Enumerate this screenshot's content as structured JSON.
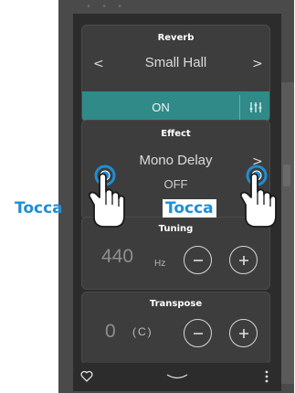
{
  "reverb": {
    "title": "Reverb",
    "value": "Small Hall",
    "status": "ON",
    "left_arrow": "<",
    "right_arrow": ">"
  },
  "effect": {
    "title": "Effect",
    "value": "Mono Delay",
    "status": "OFF",
    "right_arrow": ">"
  },
  "tuning": {
    "title": "Tuning",
    "value": "440",
    "unit": "Hz"
  },
  "transpose": {
    "title": "Transpose",
    "value": "0",
    "key": "(C)"
  },
  "overlay": {
    "tap_left": "Tocca",
    "tap_right": "Tocca"
  },
  "colors": {
    "accent_teal": "#2f8a88",
    "tap_blue": "#1f8ed6",
    "panel": "#2c2c2c",
    "card": "#3d3d3d"
  },
  "icons": {
    "settings": "sliders-icon",
    "minus": "minus-icon",
    "plus": "plus-icon",
    "favorite": "heart-icon",
    "collapse": "chevron-down-icon",
    "menu": "more-vertical-icon",
    "hand": "tap-hand-icon"
  }
}
